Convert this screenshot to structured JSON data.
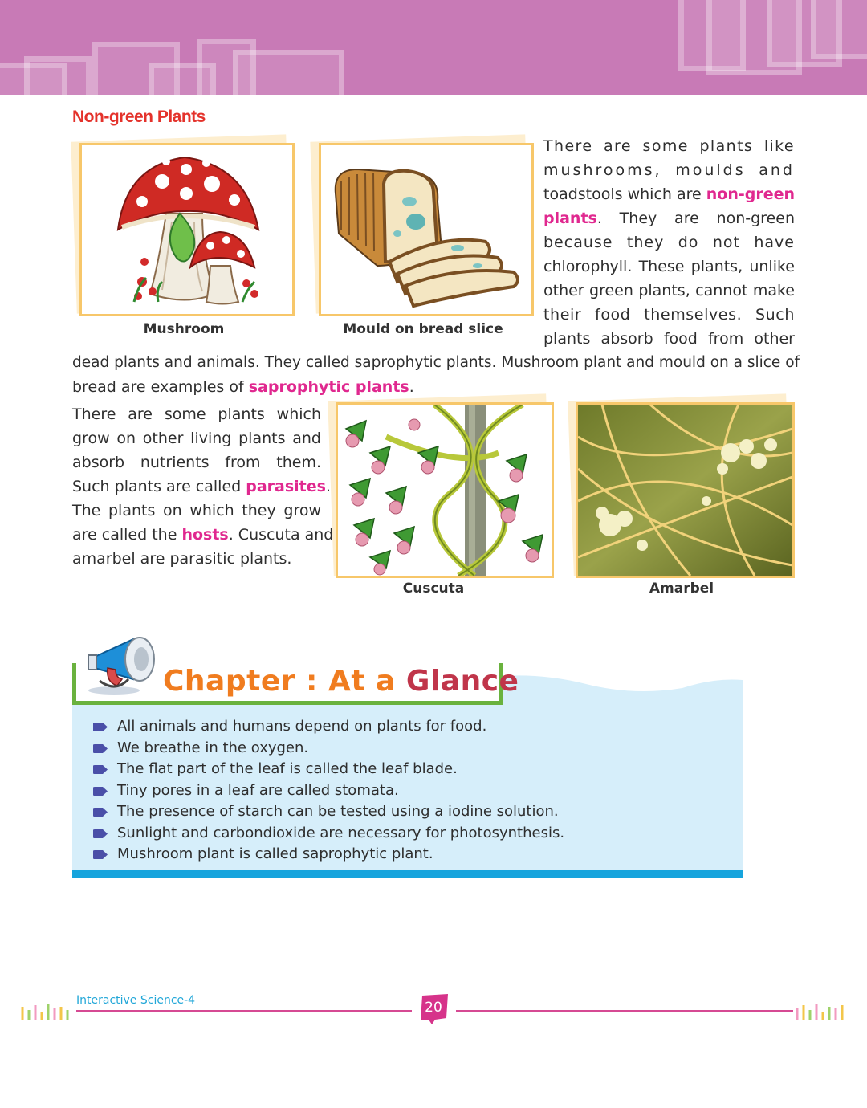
{
  "section": {
    "title": "Non-green Plants"
  },
  "figures": {
    "mushroom_caption": "Mushroom",
    "mould_caption": "Mould on bread slice",
    "cuscuta_caption": "Cuscuta",
    "amarbel_caption": "Amarbel"
  },
  "paragraph1": {
    "l1": "There are some plants like",
    "l2": "mushrooms, moulds and",
    "l3_pre": "toadstools which are ",
    "l3_hl": "non-green",
    "l4_hl": "plants",
    "l4_post": ". They are non-green",
    "l5": "because they do not have",
    "l6": "chlorophyll. These plants, unlike",
    "l7": "other green plants, cannot make",
    "l8": "their food themselves. Such",
    "l9": "plants absorb food from other",
    "l10": "dead plants and animals. They called saprophytic plants. Mushroom plant and mould on a slice of",
    "l11_pre": "bread are examples of ",
    "l11_hl": "saprophytic plants",
    "l11_post": "."
  },
  "paragraph2": {
    "l1": "There are some plants which",
    "l2": "grow on other living plants and",
    "l3": "absorb nutrients from them.",
    "l4_pre": "Such plants are called ",
    "l4_hl": "parasites",
    "l4_post": ".",
    "l5": "The plants on which they grow",
    "l6_pre": "are called the ",
    "l6_hl": "hosts",
    "l6_post": ". Cuscuta and",
    "l7": "amarbel are parasitic plants."
  },
  "glance": {
    "title_part1": "Chapter : At a ",
    "title_part2": "Glance",
    "bullets": [
      "All animals and humans depend on plants for food.",
      "We breathe in the oxygen.",
      "The flat part of the leaf is called the leaf blade.",
      "Tiny pores in a leaf are called stomata.",
      "The presence of starch can be tested using a iodine solution.",
      "Sunlight and carbondioxide are necessary for photosynthesis.",
      "Mushroom plant is called saprophytic plant."
    ]
  },
  "footer": {
    "book_title": "Interactive Science-4",
    "page_number": "20"
  },
  "colors": {
    "header_band": "#c87ab6",
    "highlight": "#e0288f",
    "section_title": "#e4322b",
    "glance_box": "#d6eefa",
    "glance_rule": "#16a4dd",
    "frame_border": "#f7c76a"
  }
}
